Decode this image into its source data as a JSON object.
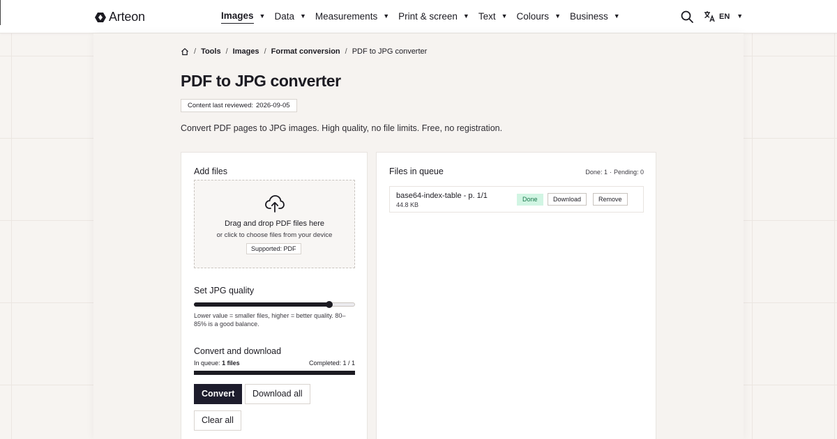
{
  "header": {
    "logo_text": "Arteon",
    "nav": [
      {
        "label": "Images",
        "active": true
      },
      {
        "label": "Data",
        "active": false
      },
      {
        "label": "Measurements",
        "active": false
      },
      {
        "label": "Print & screen",
        "active": false
      },
      {
        "label": "Text",
        "active": false
      },
      {
        "label": "Colours",
        "active": false
      },
      {
        "label": "Business",
        "active": false
      }
    ],
    "caret": "▼",
    "language": "EN",
    "icons": {
      "search": "search-icon",
      "language": "translate-icon",
      "logo": "arteon-logo-icon"
    }
  },
  "breadcrumb": {
    "home_icon": "home-icon",
    "separator": "/",
    "items": [
      "Tools",
      "Images",
      "Format conversion"
    ],
    "current": "PDF to JPG converter"
  },
  "page": {
    "title": "PDF to JPG converter",
    "reviewed_label": "Content last reviewed:",
    "reviewed_date": "2026-09-05",
    "subtitle": "Convert PDF pages to JPG images. High quality, no file limits. Free, no registration."
  },
  "add_files": {
    "title": "Add files",
    "upload_icon": "cloud-upload-icon",
    "drop_main": "Drag and drop PDF files here",
    "drop_sub": "or click to choose files from your device",
    "supported": "Supported: PDF"
  },
  "quality": {
    "title": "Set JPG quality",
    "value_fraction": 0.84,
    "hint": "Lower value = smaller files, higher = better quality. 80–85% is a good balance."
  },
  "convert": {
    "title": "Convert and download",
    "in_queue_label": "In queue:",
    "in_queue_value": "1 files",
    "completed": "Completed: 1 / 1",
    "progress_fraction": 1.0,
    "convert_label": "Convert",
    "download_all_label": "Download all",
    "clear_all_label": "Clear all"
  },
  "queue": {
    "title": "Files in queue",
    "done_count": "Done: 1",
    "separator": "·",
    "pending_count": "Pending: 0",
    "files": [
      {
        "name": "base64-index-table - p. 1/1",
        "size": "44.8 KB",
        "status": "Done",
        "download_label": "Download",
        "remove_label": "Remove"
      }
    ]
  },
  "colors": {
    "accent_dark": "#1d1c2c",
    "status_done_bg": "#d1f5e3",
    "status_done_text": "#16764a"
  }
}
